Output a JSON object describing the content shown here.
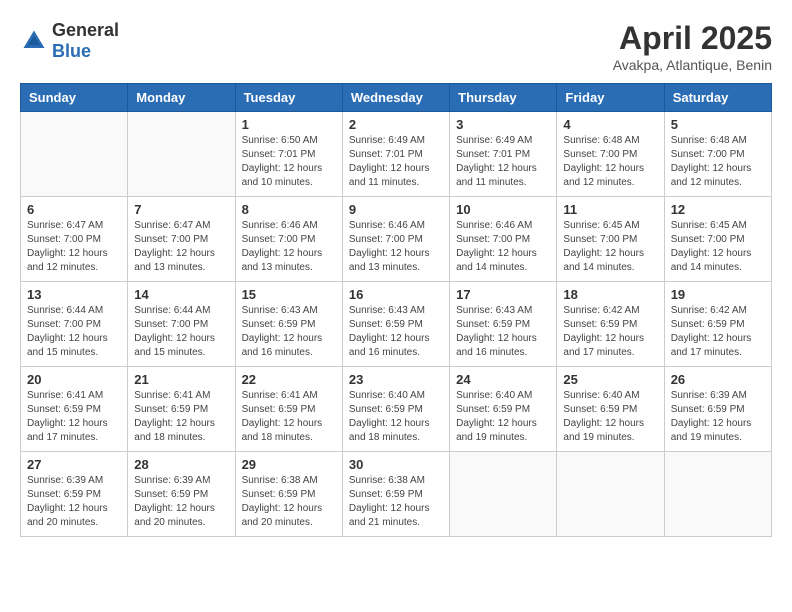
{
  "logo": {
    "general": "General",
    "blue": "Blue"
  },
  "title": "April 2025",
  "location": "Avakpa, Atlantique, Benin",
  "days_of_week": [
    "Sunday",
    "Monday",
    "Tuesday",
    "Wednesday",
    "Thursday",
    "Friday",
    "Saturday"
  ],
  "weeks": [
    [
      {
        "day": "",
        "info": ""
      },
      {
        "day": "",
        "info": ""
      },
      {
        "day": "1",
        "info": "Sunrise: 6:50 AM\nSunset: 7:01 PM\nDaylight: 12 hours and 10 minutes."
      },
      {
        "day": "2",
        "info": "Sunrise: 6:49 AM\nSunset: 7:01 PM\nDaylight: 12 hours and 11 minutes."
      },
      {
        "day": "3",
        "info": "Sunrise: 6:49 AM\nSunset: 7:01 PM\nDaylight: 12 hours and 11 minutes."
      },
      {
        "day": "4",
        "info": "Sunrise: 6:48 AM\nSunset: 7:00 PM\nDaylight: 12 hours and 12 minutes."
      },
      {
        "day": "5",
        "info": "Sunrise: 6:48 AM\nSunset: 7:00 PM\nDaylight: 12 hours and 12 minutes."
      }
    ],
    [
      {
        "day": "6",
        "info": "Sunrise: 6:47 AM\nSunset: 7:00 PM\nDaylight: 12 hours and 12 minutes."
      },
      {
        "day": "7",
        "info": "Sunrise: 6:47 AM\nSunset: 7:00 PM\nDaylight: 12 hours and 13 minutes."
      },
      {
        "day": "8",
        "info": "Sunrise: 6:46 AM\nSunset: 7:00 PM\nDaylight: 12 hours and 13 minutes."
      },
      {
        "day": "9",
        "info": "Sunrise: 6:46 AM\nSunset: 7:00 PM\nDaylight: 12 hours and 13 minutes."
      },
      {
        "day": "10",
        "info": "Sunrise: 6:46 AM\nSunset: 7:00 PM\nDaylight: 12 hours and 14 minutes."
      },
      {
        "day": "11",
        "info": "Sunrise: 6:45 AM\nSunset: 7:00 PM\nDaylight: 12 hours and 14 minutes."
      },
      {
        "day": "12",
        "info": "Sunrise: 6:45 AM\nSunset: 7:00 PM\nDaylight: 12 hours and 14 minutes."
      }
    ],
    [
      {
        "day": "13",
        "info": "Sunrise: 6:44 AM\nSunset: 7:00 PM\nDaylight: 12 hours and 15 minutes."
      },
      {
        "day": "14",
        "info": "Sunrise: 6:44 AM\nSunset: 7:00 PM\nDaylight: 12 hours and 15 minutes."
      },
      {
        "day": "15",
        "info": "Sunrise: 6:43 AM\nSunset: 6:59 PM\nDaylight: 12 hours and 16 minutes."
      },
      {
        "day": "16",
        "info": "Sunrise: 6:43 AM\nSunset: 6:59 PM\nDaylight: 12 hours and 16 minutes."
      },
      {
        "day": "17",
        "info": "Sunrise: 6:43 AM\nSunset: 6:59 PM\nDaylight: 12 hours and 16 minutes."
      },
      {
        "day": "18",
        "info": "Sunrise: 6:42 AM\nSunset: 6:59 PM\nDaylight: 12 hours and 17 minutes."
      },
      {
        "day": "19",
        "info": "Sunrise: 6:42 AM\nSunset: 6:59 PM\nDaylight: 12 hours and 17 minutes."
      }
    ],
    [
      {
        "day": "20",
        "info": "Sunrise: 6:41 AM\nSunset: 6:59 PM\nDaylight: 12 hours and 17 minutes."
      },
      {
        "day": "21",
        "info": "Sunrise: 6:41 AM\nSunset: 6:59 PM\nDaylight: 12 hours and 18 minutes."
      },
      {
        "day": "22",
        "info": "Sunrise: 6:41 AM\nSunset: 6:59 PM\nDaylight: 12 hours and 18 minutes."
      },
      {
        "day": "23",
        "info": "Sunrise: 6:40 AM\nSunset: 6:59 PM\nDaylight: 12 hours and 18 minutes."
      },
      {
        "day": "24",
        "info": "Sunrise: 6:40 AM\nSunset: 6:59 PM\nDaylight: 12 hours and 19 minutes."
      },
      {
        "day": "25",
        "info": "Sunrise: 6:40 AM\nSunset: 6:59 PM\nDaylight: 12 hours and 19 minutes."
      },
      {
        "day": "26",
        "info": "Sunrise: 6:39 AM\nSunset: 6:59 PM\nDaylight: 12 hours and 19 minutes."
      }
    ],
    [
      {
        "day": "27",
        "info": "Sunrise: 6:39 AM\nSunset: 6:59 PM\nDaylight: 12 hours and 20 minutes."
      },
      {
        "day": "28",
        "info": "Sunrise: 6:39 AM\nSunset: 6:59 PM\nDaylight: 12 hours and 20 minutes."
      },
      {
        "day": "29",
        "info": "Sunrise: 6:38 AM\nSunset: 6:59 PM\nDaylight: 12 hours and 20 minutes."
      },
      {
        "day": "30",
        "info": "Sunrise: 6:38 AM\nSunset: 6:59 PM\nDaylight: 12 hours and 21 minutes."
      },
      {
        "day": "",
        "info": ""
      },
      {
        "day": "",
        "info": ""
      },
      {
        "day": "",
        "info": ""
      }
    ]
  ]
}
